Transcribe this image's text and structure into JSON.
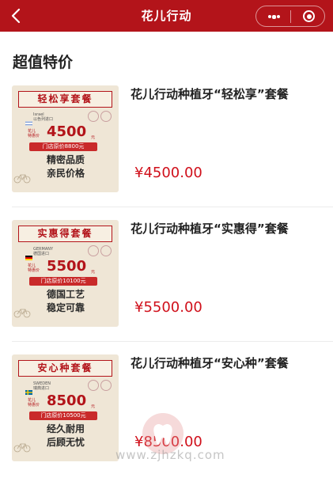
{
  "header": {
    "title": "花儿行动",
    "back_icon": "chevron-left-icon",
    "more_icon": "more-dots-icon",
    "close_icon": "record-circle-icon"
  },
  "colors": {
    "brand_red": "#b3141a",
    "price_red": "#d0101b"
  },
  "section": {
    "title": "超值特价"
  },
  "products": [
    {
      "name": "花儿行动种植牙“轻松享”套餐",
      "price": "¥4500.00",
      "image": {
        "banner": "轻松享套餐",
        "country": "Israel\n以色列进口",
        "flag": "israel",
        "label": "花儿\n特惠价",
        "big_price": "4500",
        "unit": "元",
        "original": "门店原价8800元",
        "slogan_1": "精密品质",
        "slogan_2": "亲民价格"
      }
    },
    {
      "name": "花儿行动种植牙“实惠得”套餐",
      "price": "¥5500.00",
      "image": {
        "banner": "实惠得套餐",
        "country": "GERMANY\n德国进口",
        "flag": "germany",
        "label": "花儿\n特惠价",
        "big_price": "5500",
        "unit": "元",
        "original": "门店原价10100元",
        "slogan_1": "德国工艺",
        "slogan_2": "稳定可靠"
      }
    },
    {
      "name": "花儿行动种植牙“安心种”套餐",
      "price": "¥8500.00",
      "image": {
        "banner": "安心种套餐",
        "country": "SWEDEN\n瑞典进口",
        "flag": "sweden",
        "label": "花儿\n特惠价",
        "big_price": "8500",
        "unit": "元",
        "original": "门店原价10500元",
        "slogan_1": "经久耐用",
        "slogan_2": "后顾无忧"
      }
    }
  ],
  "watermark": {
    "text": "www.zjhzkq.com"
  }
}
